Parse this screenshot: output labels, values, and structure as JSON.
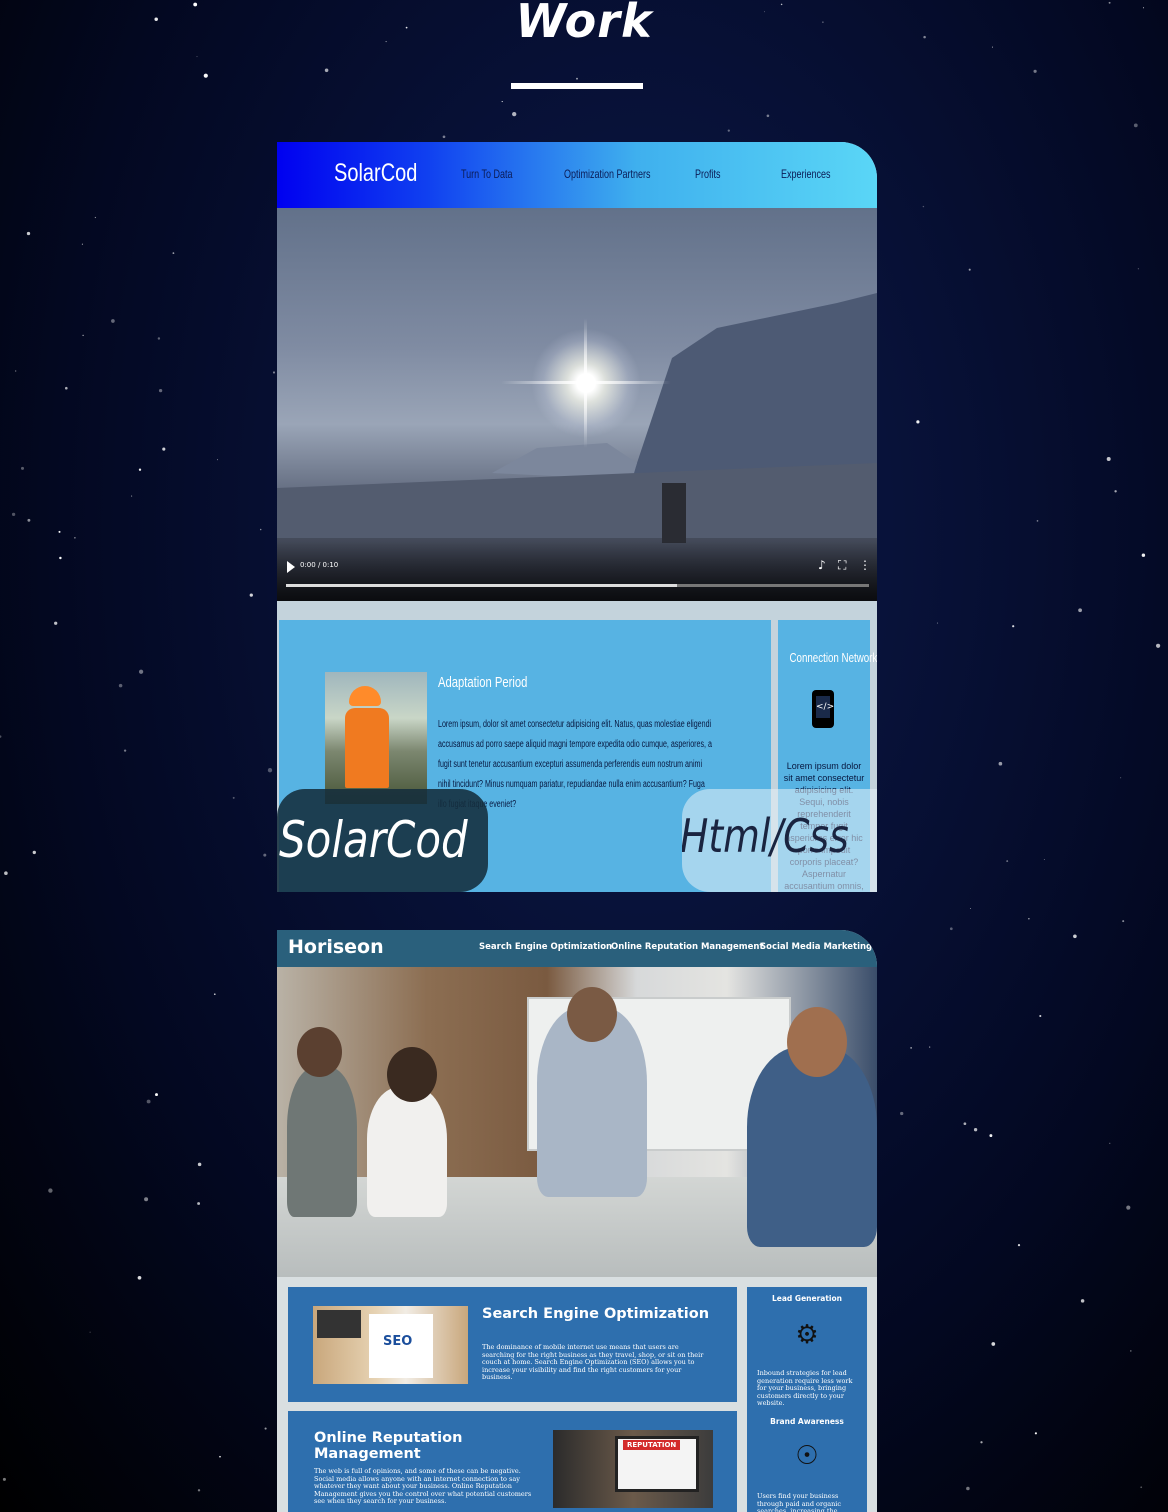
{
  "page": {
    "title": "Work"
  },
  "projects": [
    {
      "site": {
        "logo": "SolarCod",
        "nav": [
          "Turn To Data",
          "Optimization Partners",
          "Profits",
          "Experiences"
        ],
        "video": {
          "time": "0:00 / 0:10",
          "progress": 0.67
        },
        "article": {
          "heading": "Adaptation Period",
          "body": "Lorem ipsum, dolor sit amet consectetur adipisicing elit. Natus, quas molestiae eligendi accusamus ad porro saepe aliquid magni tempore expedita odio cumque, asperiores, a fugit sunt tenetur accusantium excepturi assumenda perferendis eum nostrum animi nihil tincidunt? Minus numquam pariatur, repudiandae nulla enim accusantium? Fuga illo fugiat itaque eveniet?"
        },
        "aside": {
          "heading": "Connection Network",
          "body": "Lorem ipsum dolor sit amet consectetur adipisicing elit. Sequi, nobis reprehenderit tempor fugit asperiores error hic porro impedit corporis placeat? Aspernatur accusantium omnis, cumque fuga placeat sunt natus itaque architecto. Ullam, id"
        }
      },
      "label_name": "SolarCod",
      "label_tech": "Html/Css"
    },
    {
      "site": {
        "logo": "Horiseon",
        "nav": [
          "Search Engine Optimization",
          "Online Reputation Management",
          "Social Media Marketing"
        ],
        "sections": [
          {
            "heading": "Search Engine Optimization",
            "body": "The dominance of mobile internet use means that users are searching for the right business as they travel, shop, or sit on their couch at home. Search Engine Optimization (SEO) allows you to increase your visibility and find the right customers for your business.",
            "image_badge": "SEO"
          },
          {
            "heading": "Online Reputation Management",
            "body": "The web is full of opinions, and some of these can be negative. Social media allows anyone with an internet connection to say whatever they want about your business. Online Reputation Management gives you the control over what potential customers see when they search for your business.",
            "image_badge": "REPUTATION"
          }
        ],
        "benefits": [
          {
            "heading": "Lead Generation",
            "icon": "lightbulb-gear-icon",
            "body": "Inbound strategies for lead generation require less work for your business, bringing customers directly to your website."
          },
          {
            "heading": "Brand Awareness",
            "icon": "broadcast-icon",
            "body": "Users find your business through paid and organic searches, increasing the"
          }
        ]
      }
    }
  ]
}
